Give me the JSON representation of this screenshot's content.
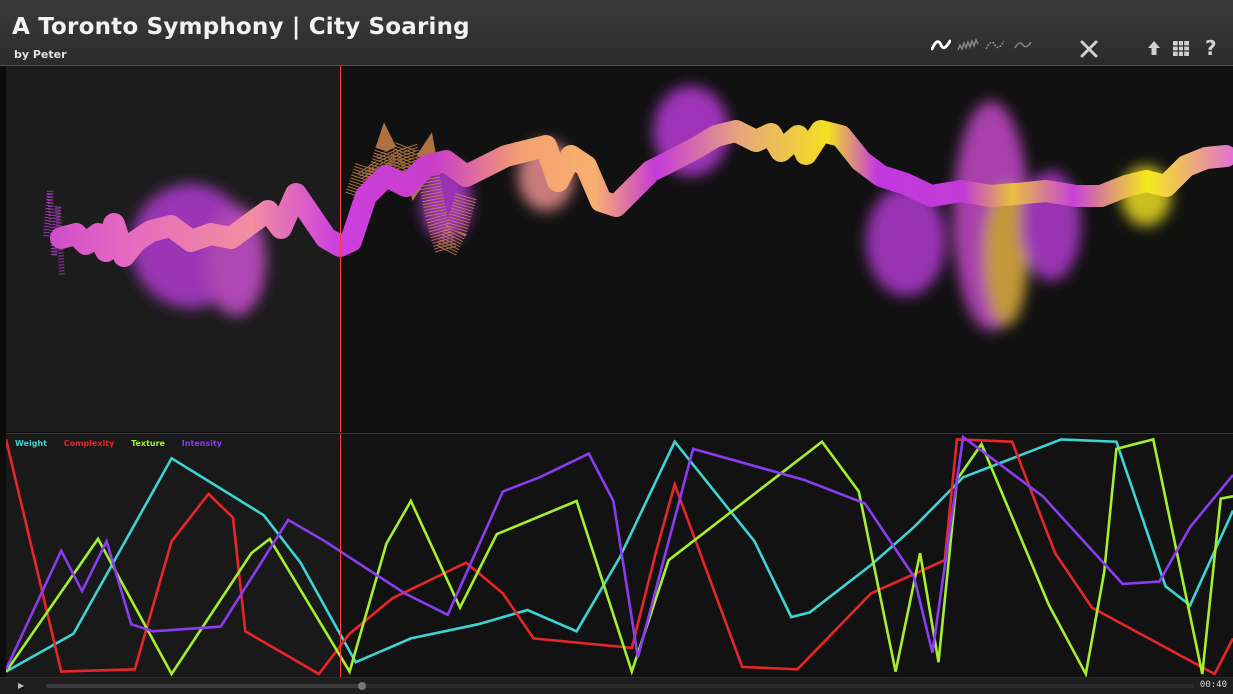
{
  "header": {
    "title": "A Toronto Symphony | City Soaring",
    "subtitle": "by Peter"
  },
  "toolbar": {
    "buttons": [
      {
        "name": "view-smooth-icon",
        "active": true
      },
      {
        "name": "view-complex-icon",
        "active": false
      },
      {
        "name": "view-textured-icon",
        "active": false
      },
      {
        "name": "view-intense-icon",
        "active": false
      },
      {
        "name": "close-icon"
      },
      {
        "name": "upload-icon"
      },
      {
        "name": "grid-icon"
      }
    ],
    "help_label": "?"
  },
  "legend": [
    {
      "name": "Weight",
      "color": "#3fd3d3"
    },
    {
      "name": "Complexity",
      "color": "#e8262a"
    },
    {
      "name": "Texture",
      "color": "#a5f02c"
    },
    {
      "name": "Intensity",
      "color": "#8a3cf0"
    }
  ],
  "playback": {
    "progress": 0.275,
    "time": "00:40"
  },
  "chart_data": {
    "type": "line",
    "xlim": [
      0,
      1
    ],
    "ylim": [
      0,
      1
    ],
    "series": [
      {
        "name": "Weight",
        "color": "#3fd3d3",
        "points": [
          [
            0,
            0.01
          ],
          [
            0.055,
            0.17
          ],
          [
            0.135,
            0.91
          ],
          [
            0.21,
            0.67
          ],
          [
            0.24,
            0.47
          ],
          [
            0.285,
            0.05
          ],
          [
            0.33,
            0.15
          ],
          [
            0.385,
            0.21
          ],
          [
            0.425,
            0.27
          ],
          [
            0.465,
            0.18
          ],
          [
            0.5,
            0.49
          ],
          [
            0.545,
            0.98
          ],
          [
            0.61,
            0.56
          ],
          [
            0.64,
            0.24
          ],
          [
            0.655,
            0.26
          ],
          [
            0.705,
            0.46
          ],
          [
            0.74,
            0.62
          ],
          [
            0.78,
            0.83
          ],
          [
            0.86,
            0.99
          ],
          [
            0.905,
            0.98
          ],
          [
            0.945,
            0.37
          ],
          [
            0.965,
            0.29
          ],
          [
            1,
            0.69
          ]
        ]
      },
      {
        "name": "Complexity",
        "color": "#e8262a",
        "points": [
          [
            0,
            0.99
          ],
          [
            0.045,
            0.01
          ],
          [
            0.105,
            0.02
          ],
          [
            0.135,
            0.56
          ],
          [
            0.165,
            0.76
          ],
          [
            0.185,
            0.66
          ],
          [
            0.195,
            0.18
          ],
          [
            0.255,
            0.0
          ],
          [
            0.28,
            0.17
          ],
          [
            0.315,
            0.32
          ],
          [
            0.375,
            0.47
          ],
          [
            0.405,
            0.34
          ],
          [
            0.43,
            0.15
          ],
          [
            0.51,
            0.11
          ],
          [
            0.53,
            0.52
          ],
          [
            0.545,
            0.8
          ],
          [
            0.6,
            0.03
          ],
          [
            0.645,
            0.02
          ],
          [
            0.705,
            0.34
          ],
          [
            0.765,
            0.48
          ],
          [
            0.775,
            0.99
          ],
          [
            0.82,
            0.98
          ],
          [
            0.855,
            0.51
          ],
          [
            0.885,
            0.28
          ],
          [
            0.985,
            0.0
          ],
          [
            1,
            0.15
          ]
        ]
      },
      {
        "name": "Texture",
        "color": "#a5f02c",
        "points": [
          [
            0,
            0.01
          ],
          [
            0.075,
            0.57
          ],
          [
            0.135,
            0.0
          ],
          [
            0.2,
            0.51
          ],
          [
            0.215,
            0.57
          ],
          [
            0.28,
            0.01
          ],
          [
            0.31,
            0.55
          ],
          [
            0.33,
            0.73
          ],
          [
            0.37,
            0.28
          ],
          [
            0.4,
            0.59
          ],
          [
            0.465,
            0.73
          ],
          [
            0.51,
            0.01
          ],
          [
            0.54,
            0.48
          ],
          [
            0.665,
            0.98
          ],
          [
            0.695,
            0.77
          ],
          [
            0.725,
            0.01
          ],
          [
            0.745,
            0.51
          ],
          [
            0.76,
            0.05
          ],
          [
            0.775,
            0.82
          ],
          [
            0.795,
            0.97
          ],
          [
            0.85,
            0.29
          ],
          [
            0.88,
            0.0
          ],
          [
            0.895,
            0.43
          ],
          [
            0.905,
            0.95
          ],
          [
            0.935,
            0.99
          ],
          [
            0.975,
            0.0
          ],
          [
            0.99,
            0.74
          ],
          [
            1,
            0.75
          ]
        ]
      },
      {
        "name": "Intensity",
        "color": "#8a3cf0",
        "points": [
          [
            0,
            0.02
          ],
          [
            0.045,
            0.52
          ],
          [
            0.062,
            0.35
          ],
          [
            0.082,
            0.56
          ],
          [
            0.102,
            0.21
          ],
          [
            0.12,
            0.18
          ],
          [
            0.175,
            0.2
          ],
          [
            0.23,
            0.65
          ],
          [
            0.26,
            0.56
          ],
          [
            0.325,
            0.34
          ],
          [
            0.36,
            0.25
          ],
          [
            0.405,
            0.77
          ],
          [
            0.435,
            0.83
          ],
          [
            0.475,
            0.93
          ],
          [
            0.495,
            0.73
          ],
          [
            0.515,
            0.07
          ],
          [
            0.56,
            0.95
          ],
          [
            0.65,
            0.82
          ],
          [
            0.7,
            0.72
          ],
          [
            0.74,
            0.41
          ],
          [
            0.755,
            0.09
          ],
          [
            0.78,
            1.0
          ],
          [
            0.845,
            0.75
          ],
          [
            0.91,
            0.38
          ],
          [
            0.94,
            0.39
          ],
          [
            0.965,
            0.62
          ],
          [
            1,
            0.84
          ]
        ]
      }
    ]
  }
}
